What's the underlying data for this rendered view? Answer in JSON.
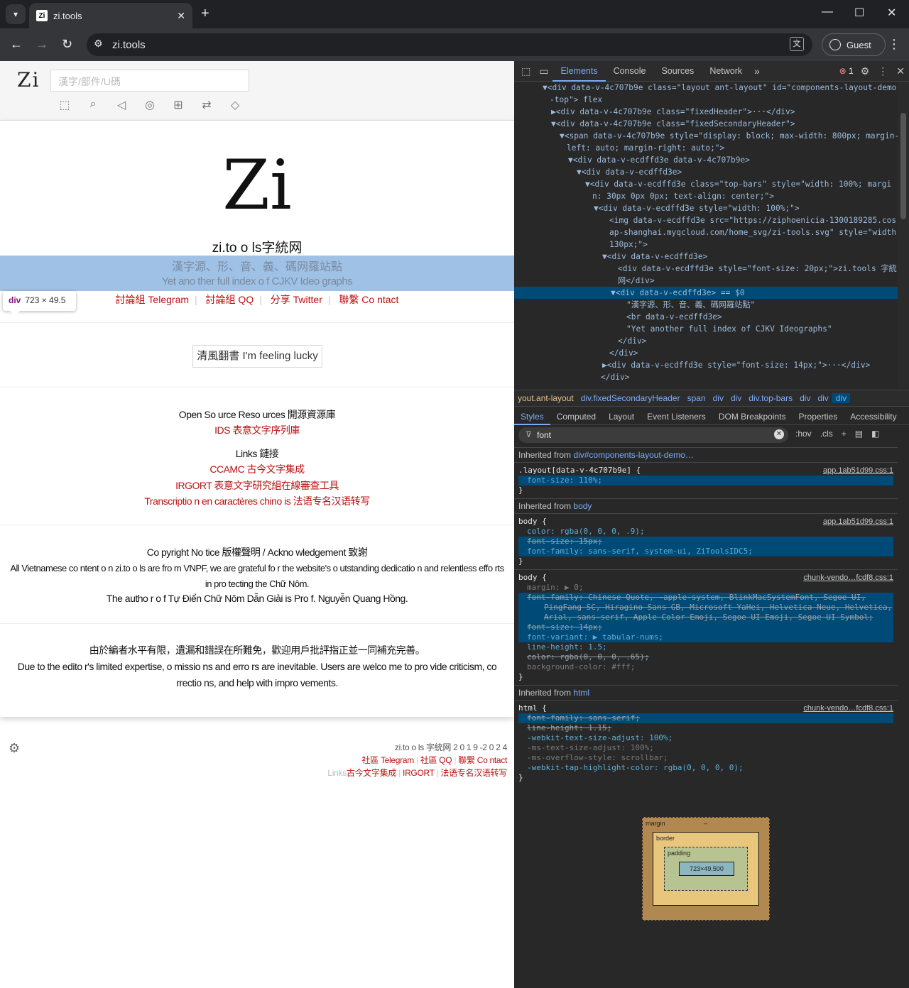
{
  "browser": {
    "tab_title": "zi.tools",
    "favicon": "Zi",
    "url": "zi.tools",
    "profile": "Guest",
    "error_count": "1"
  },
  "site": {
    "logo_small": "Zi",
    "search_placeholder": "漢字/部件/U碼",
    "logo_big": "Zi",
    "title": "zi.to o ls字統网",
    "subtitle1": "漢字源、形、音、義、碼网羅站點",
    "subtitle2": "Yet ano ther full index o f CJKV Ideo graphs",
    "top_links": [
      "討論組 Telegram",
      "討論組 QQ",
      "分享 Twitter",
      "聯繫 Co ntact"
    ],
    "lucky_button": "清風翻書 I'm feeling lucky",
    "opensource_heading": "Open So urce Reso urces 開源資源庫",
    "ids_link": "IDS 表意文字序列庫",
    "links_heading": "Links 鏈接",
    "links": [
      "CCAMC 古今文字集成",
      "IRGORT 表意文字研究組在線審查工具",
      "Transcriptio n en caractères chino is 法语专名汉语转写"
    ],
    "copyright_heading": "Co pyright No tice 版權聲明 / Ackno wledgement 致謝",
    "copyright_text": "All Vietnamese co ntent o n zi.to o ls are fro m VNPF, we are grateful fo r the website's o utstanding dedicatio n and relentless effo rts in pro tecting the Chữ Nôm.",
    "author_text": "The autho r o f Tự Điển Chữ Nôm Dẫn Giải is Pro f. Nguyễn Quang Hồng.",
    "disclaimer_cn": "由於編者水平有限，遺漏和錯誤在所難免，歡迎用戶批評指正並一同補充完善。",
    "disclaimer_en": "Due to the edito r's limited expertise, o missio ns and erro rs are inevitable. Users are welco me to pro vide criticism, co rrectio ns, and help with impro vements.",
    "footer_copy": "zi.to o ls 字統网 2 0 1 9 -2 0 2 4",
    "footer_links1": [
      "社區 Telegram",
      "社區 QQ",
      "聯繫 Co ntact"
    ],
    "footer_links2_prefix": "Links",
    "footer_links2": [
      "古今文字集成",
      "IRGORT",
      "法语专名汉语转写"
    ],
    "tooltip_tag": "div",
    "tooltip_size": "723 × 49.5"
  },
  "devtools": {
    "tabs": [
      "Elements",
      "Console",
      "Sources",
      "Network"
    ],
    "dom_lines": [
      {
        "t": "▼<div data-v-4c707b9e class=\"layout ant-layout\" id=\"components-layout-demo",
        "i": 40
      },
      {
        "t": "-top\"> flex",
        "i": 50
      },
      {
        "t": "▶<div data-v-4c707b9e class=\"fixedHeader\">···</div>",
        "i": 52
      },
      {
        "t": "▼<div data-v-4c707b9e class=\"fixedSecondaryHeader\">",
        "i": 52
      },
      {
        "t": "▼<span data-v-4c707b9e style=\"display: block; max-width: 800px; margin-",
        "i": 64
      },
      {
        "t": "left: auto; margin-right: auto;\">",
        "i": 74
      },
      {
        "t": "▼<div data-v-ecdffd3e data-v-4c707b9e>",
        "i": 76
      },
      {
        "t": "▼<div data-v-ecdffd3e>",
        "i": 88
      },
      {
        "t": "▼<div data-v-ecdffd3e class=\"top-bars\" style=\"width: 100%; margi",
        "i": 100
      },
      {
        "t": "n: 30px 0px 0px; text-align: center;\">",
        "i": 110
      },
      {
        "t": "▼<div data-v-ecdffd3e style=\"width: 100%;\">",
        "i": 112
      },
      {
        "t": "<img data-v-ecdffd3e src=\"https://ziphoenicia-1300189285.cos.",
        "i": 134
      },
      {
        "t": "ap-shanghai.myqcloud.com/home_svg/zi-tools.svg\" style=\"width:",
        "i": 134
      },
      {
        "t": "130px;\">",
        "i": 134
      },
      {
        "t": "▼<div data-v-ecdffd3e>",
        "i": 124
      },
      {
        "t": "<div data-v-ecdffd3e style=\"font-size: 20px;\">zi.tools 字統",
        "i": 146
      },
      {
        "t": "网</div>",
        "i": 146
      },
      {
        "t": "▼<div data-v-ecdffd3e> == $0",
        "i": 136,
        "sel": true
      },
      {
        "t": "\"漢字源、形、音、義、碼网羅站點\"",
        "i": 158
      },
      {
        "t": "<br data-v-ecdffd3e>",
        "i": 158
      },
      {
        "t": "\"Yet another full index of CJKV Ideographs\"",
        "i": 158
      },
      {
        "t": "</div>",
        "i": 146
      },
      {
        "t": "</div>",
        "i": 134
      },
      {
        "t": "▶<div data-v-ecdffd3e style=\"font-size: 14px;\">···</div>",
        "i": 124
      },
      {
        "t": "</div>",
        "i": 122
      }
    ],
    "breadcrumbs": [
      "yout.ant-layout",
      "div.fixedSecondaryHeader",
      "span",
      "div",
      "div",
      "div.top-bars",
      "div",
      "div",
      "div"
    ],
    "subtabs": [
      "Styles",
      "Computed",
      "Layout",
      "Event Listeners",
      "DOM Breakpoints",
      "Properties",
      "Accessibility"
    ],
    "filter": "font",
    "filter_tools": [
      ":hov",
      ".cls",
      "+"
    ],
    "inherited1": "Inherited from",
    "inherited1_link": "div#components-layout-demo…",
    "rule1_sel": ".layout[data-v-4c707b9e] {",
    "rule1_src": "app.1ab51d99.css:1",
    "rule1_prop": "font-size: 110%;",
    "inherited2_link": "body",
    "rule2_sel": "body {",
    "rule2_src": "app.1ab51d99.css:1",
    "rule2_props": [
      "color: rgba(0, 0, 0, .9);",
      "font-size: 15px;",
      "font-family: sans-serif, system-ui, ZiToolsIDC5;"
    ],
    "rule3_sel": "body {",
    "rule3_src": "chunk-vendo…fcdf8.css:1",
    "rule3_props": [
      "margin: ▶ 0;",
      "font-family: Chinese Quote, -apple-system, BlinkMacSystemFont, Segoe UI,",
      "PingFang SC, Hiragino Sans GB, Microsoft YaHei, Helvetica Neue, Helvetica,",
      "Arial, sans-serif, Apple Color Emoji, Segoe UI Emoji, Segoe UI Symbol;",
      "font-size: 14px;",
      "font-variant: ▶ tabular-nums;",
      "line-height: 1.5;",
      "color: rgba(0, 0, 0, .65);",
      "background-color: #fff;"
    ],
    "inherited3_link": "html",
    "rule4_sel": "html {",
    "rule4_src": "chunk-vendo…fcdf8.css:1",
    "rule4_props": [
      "font-family: sans-serif;",
      "line-height: 1.15;",
      "-webkit-text-size-adjust: 100%;",
      "-ms-text-size-adjust: 100%;",
      "-ms-overflow-style: scrollbar;",
      "-webkit-tap-highlight-color: rgba(0, 0, 0, 0);"
    ],
    "box_margin": "margin",
    "box_border": "border",
    "box_padding": "padding",
    "box_content": "723×49.500",
    "box_dash": "–"
  }
}
